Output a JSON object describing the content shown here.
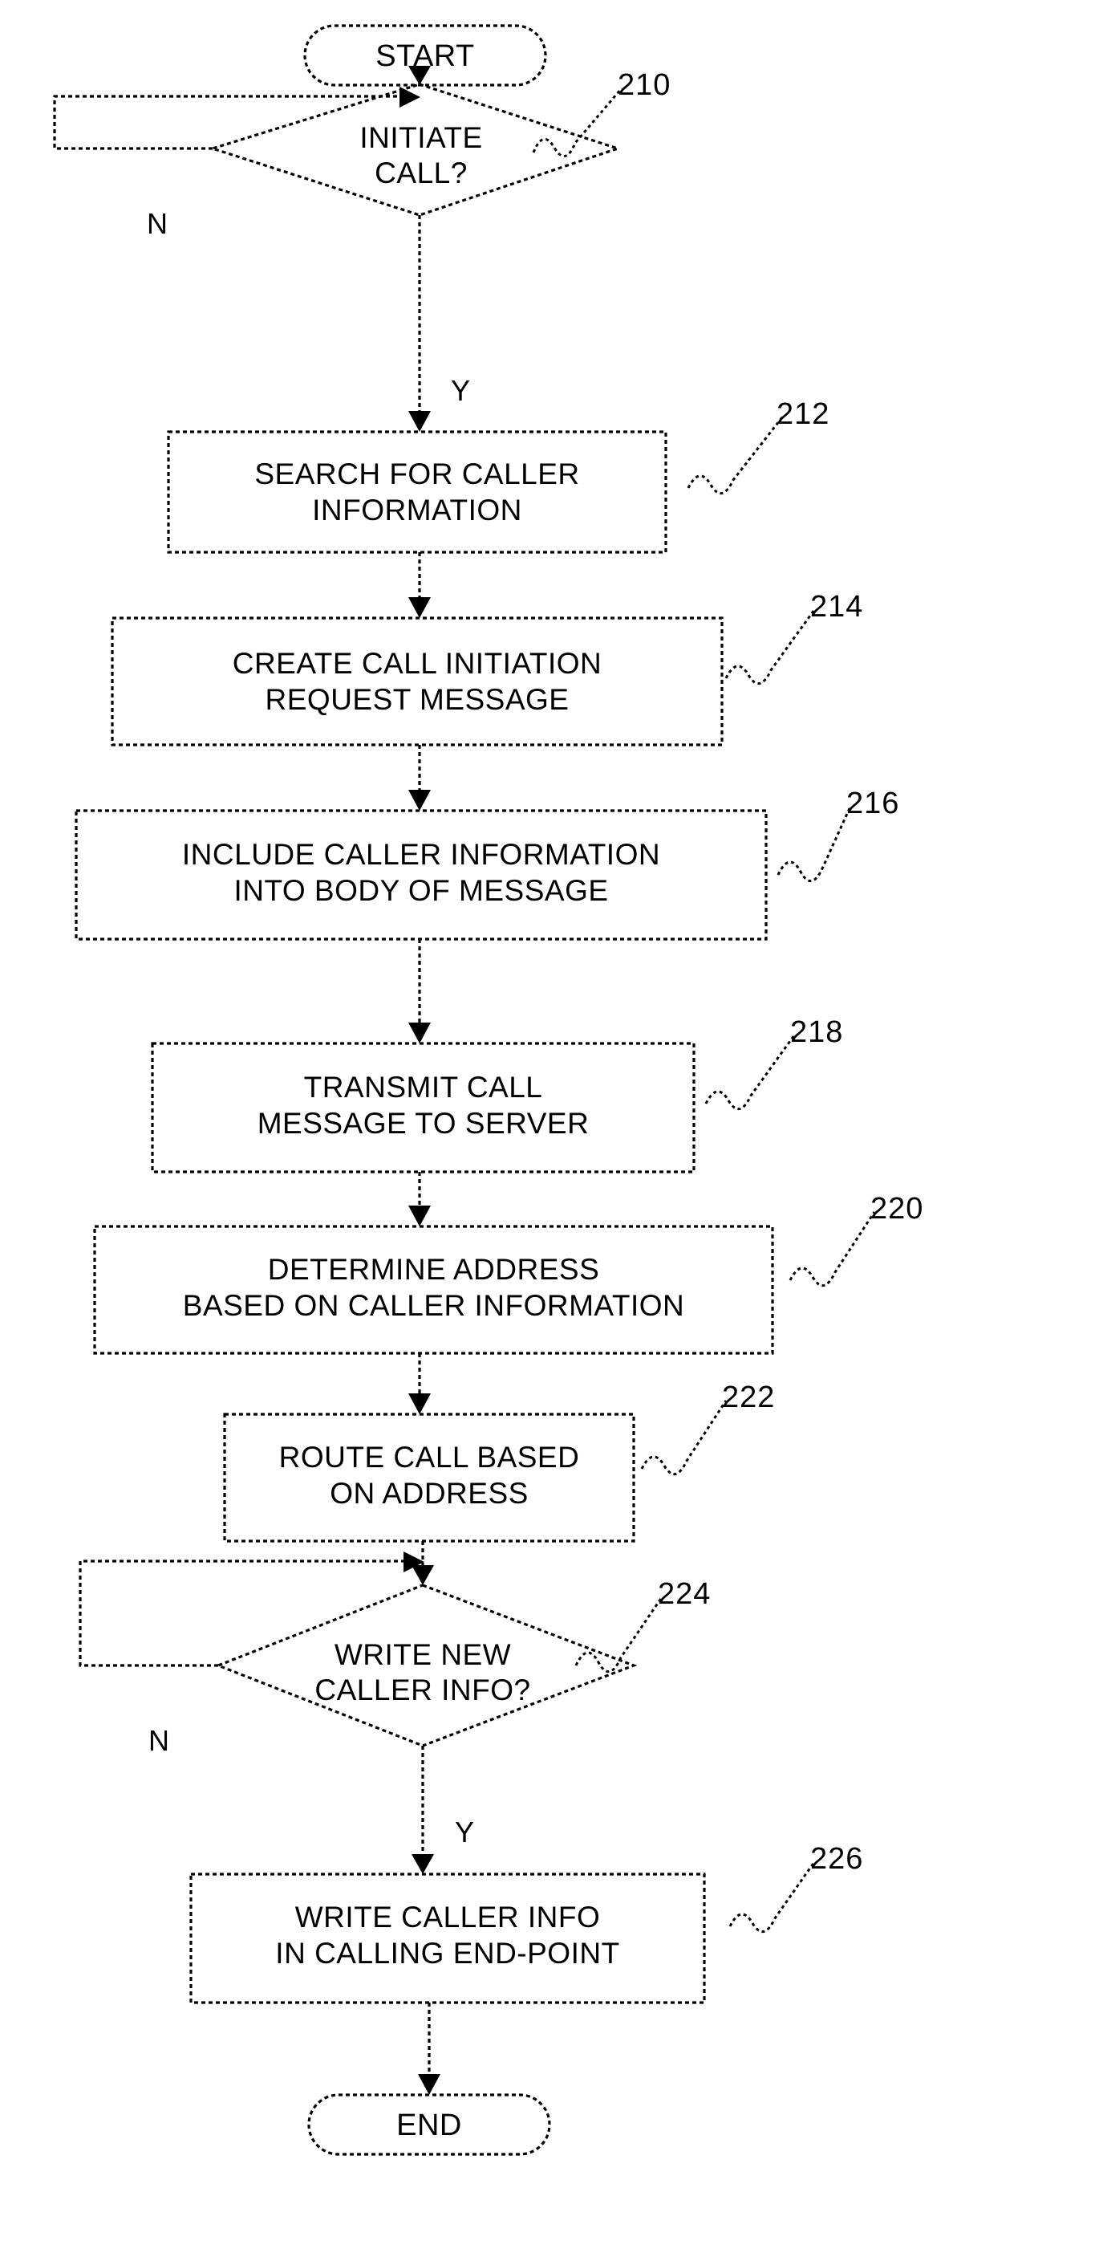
{
  "figure": {
    "type": "flowchart",
    "title": "Call initiation flow",
    "stroke_color": "#000000",
    "background_color": "#ffffff",
    "line_style": "dotted"
  },
  "nodes": [
    {
      "id": "start",
      "shape": "terminator",
      "label": "START",
      "ref": ""
    },
    {
      "id": "n210",
      "shape": "decision",
      "label": "INITIATE\nCALL?",
      "ref": "210",
      "yes_label": "Y",
      "no_label": "N"
    },
    {
      "id": "n212",
      "shape": "process",
      "label": "SEARCH FOR CALLER\nINFORMATION",
      "ref": "212"
    },
    {
      "id": "n214",
      "shape": "process",
      "label": "CREATE CALL INITIATION\nREQUEST MESSAGE",
      "ref": "214"
    },
    {
      "id": "n216",
      "shape": "process",
      "label": "INCLUDE CALLER INFORMATION\nINTO BODY OF MESSAGE",
      "ref": "216"
    },
    {
      "id": "n218",
      "shape": "process",
      "label": "TRANSMIT CALL\nMESSAGE TO SERVER",
      "ref": "218"
    },
    {
      "id": "n220",
      "shape": "process",
      "label": "DETERMINE ADDRESS\nBASED ON CALLER INFORMATION",
      "ref": "220"
    },
    {
      "id": "n222",
      "shape": "process",
      "label": "ROUTE CALL BASED\nON ADDRESS",
      "ref": "222"
    },
    {
      "id": "n224",
      "shape": "decision",
      "label": "WRITE NEW\nCALLER INFO?",
      "ref": "224",
      "yes_label": "Y",
      "no_label": "N"
    },
    {
      "id": "n226",
      "shape": "process",
      "label": "WRITE CALLER INFO\nIN CALLING END-POINT",
      "ref": "226"
    },
    {
      "id": "end",
      "shape": "terminator",
      "label": "END",
      "ref": ""
    }
  ],
  "labels": {
    "start": "START",
    "end": "END",
    "d210_line1": "INITIATE",
    "d210_line2": "CALL?",
    "d210_n": "N",
    "d210_y": "Y",
    "p212_line1": "SEARCH FOR CALLER",
    "p212_line2": "INFORMATION",
    "p214_line1": "CREATE CALL INITIATION",
    "p214_line2": "REQUEST MESSAGE",
    "p216_line1": "INCLUDE CALLER INFORMATION",
    "p216_line2": "INTO BODY OF MESSAGE",
    "p218_line1": "TRANSMIT CALL",
    "p218_line2": "MESSAGE TO SERVER",
    "p220_line1": "DETERMINE ADDRESS",
    "p220_line2": "BASED ON CALLER INFORMATION",
    "p222_line1": "ROUTE CALL BASED",
    "p222_line2": "ON ADDRESS",
    "d224_line1": "WRITE NEW",
    "d224_line2": "CALLER INFO?",
    "d224_n": "N",
    "d224_y": "Y",
    "p226_line1": "WRITE CALLER INFO",
    "p226_line2": "IN CALLING END-POINT"
  },
  "refs": {
    "r210": "210",
    "r212": "212",
    "r214": "214",
    "r216": "216",
    "r218": "218",
    "r220": "220",
    "r222": "222",
    "r224": "224",
    "r226": "226"
  }
}
